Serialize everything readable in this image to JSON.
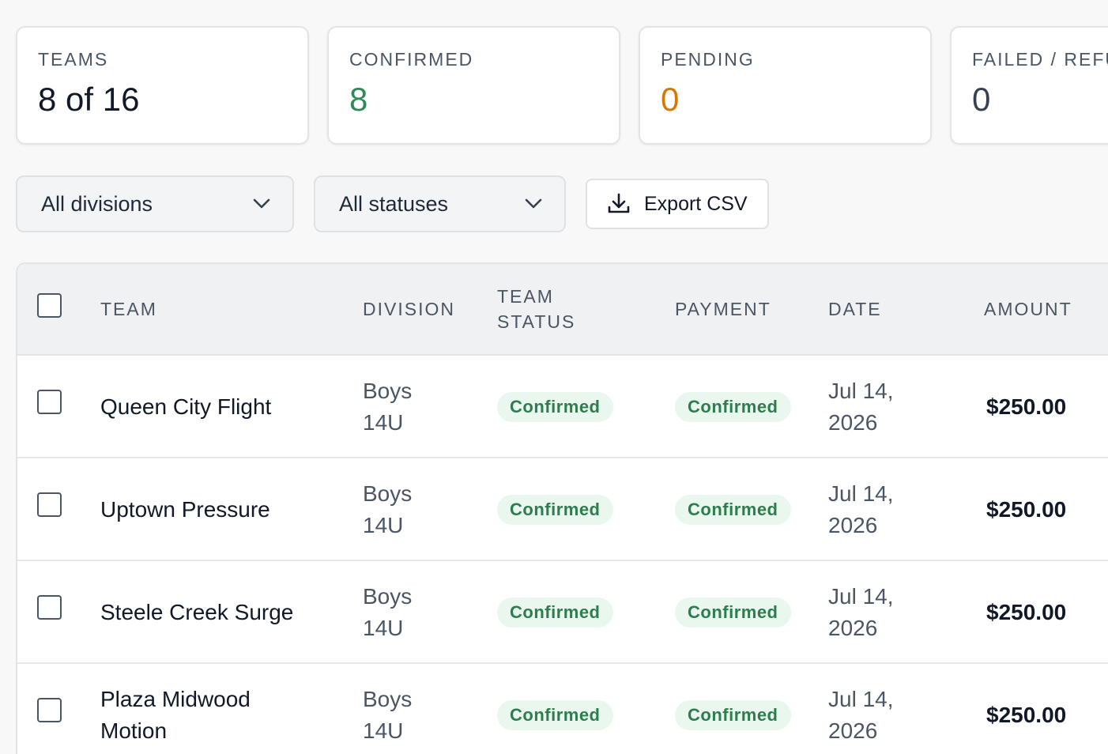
{
  "stats": [
    {
      "label": "TEAMS",
      "value": "8 of 16"
    },
    {
      "label": "CONFIRMED",
      "value": "8"
    },
    {
      "label": "PENDING",
      "value": "0"
    },
    {
      "label": "FAILED / REFU",
      "value": "0"
    }
  ],
  "filters": {
    "division_select": "All divisions",
    "status_select": "All statuses",
    "export_label": "Export CSV"
  },
  "table": {
    "headers": {
      "team": "TEAM",
      "division": "DIVISION",
      "team_status_1": "TEAM",
      "team_status_2": "STATUS",
      "payment": "PAYMENT",
      "date": "DATE",
      "amount": "AMOUNT"
    },
    "rows": [
      {
        "team_1": "Queen City Flight",
        "team_2": "",
        "division_1": "Boys",
        "division_2": "14U",
        "team_status": "Confirmed",
        "payment": "Confirmed",
        "date_1": "Jul 14,",
        "date_2": "2026",
        "amount": "$250.00"
      },
      {
        "team_1": "Uptown Pressure",
        "team_2": "",
        "division_1": "Boys",
        "division_2": "14U",
        "team_status": "Confirmed",
        "payment": "Confirmed",
        "date_1": "Jul 14,",
        "date_2": "2026",
        "amount": "$250.00"
      },
      {
        "team_1": "Steele Creek Surge",
        "team_2": "",
        "division_1": "Boys",
        "division_2": "14U",
        "team_status": "Confirmed",
        "payment": "Confirmed",
        "date_1": "Jul 14,",
        "date_2": "2026",
        "amount": "$250.00"
      },
      {
        "team_1": "Plaza Midwood",
        "team_2": "Motion",
        "division_1": "Boys",
        "division_2": "14U",
        "team_status": "Confirmed",
        "payment": "Confirmed",
        "date_1": "Jul 14,",
        "date_2": "2026",
        "amount": "$250.00"
      }
    ]
  },
  "colors": {
    "confirmed": "#2e8b57",
    "pending": "#d97706",
    "badge_bg": "#e9f7ee",
    "badge_text": "#2e7d4f"
  }
}
